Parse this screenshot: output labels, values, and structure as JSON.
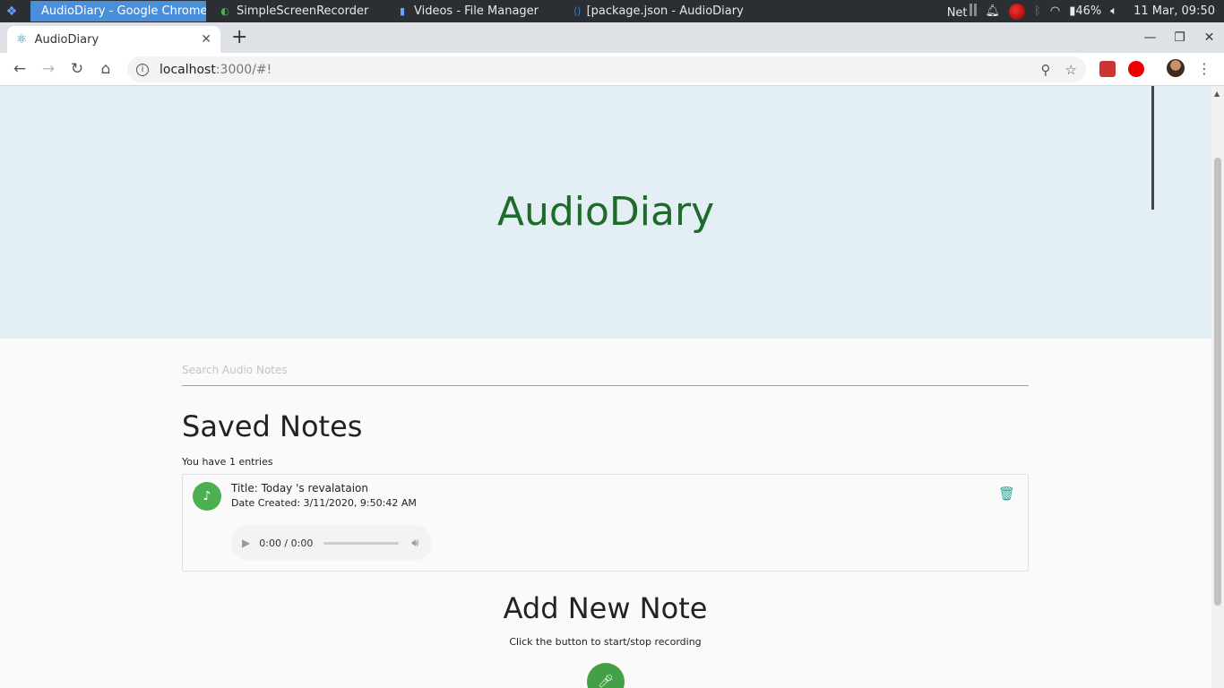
{
  "taskbar": {
    "tasks": [
      {
        "label": "AudioDiary - Google Chrome",
        "icon": "chrome-icon",
        "active": true
      },
      {
        "label": "SimpleScreenRecorder",
        "icon": "recorder-icon",
        "active": false
      },
      {
        "label": "Videos - File Manager",
        "icon": "folder-icon",
        "active": false
      },
      {
        "label": "[package.json - AudioDiary ...",
        "icon": "vscode-icon",
        "active": false
      }
    ],
    "net_label": "Net",
    "battery": "46%",
    "clock": "11 Mar, 09:50"
  },
  "browser": {
    "tab_title": "AudioDiary",
    "url_host": "localhost",
    "url_rest": ":3000/#!"
  },
  "page": {
    "hero_title": "AudioDiary",
    "search_placeholder": "Search Audio Notes",
    "saved_title": "Saved Notes",
    "entries_text": "You have 1 entries",
    "notes": [
      {
        "title": "Title: Today 's revalataion",
        "date": "Date Created: 3/11/2020, 9:50:42 AM",
        "player_time": "0:00 / 0:00"
      }
    ],
    "add_title": "Add New Note",
    "add_hint": "Click the button to start/stop recording"
  },
  "colors": {
    "hero_bg": "#e3eef5",
    "hero_title": "#1f6b2a",
    "accent_green": "#4caf50",
    "delete_teal": "#26a69a",
    "taskbar_active": "#4a8fd9"
  }
}
